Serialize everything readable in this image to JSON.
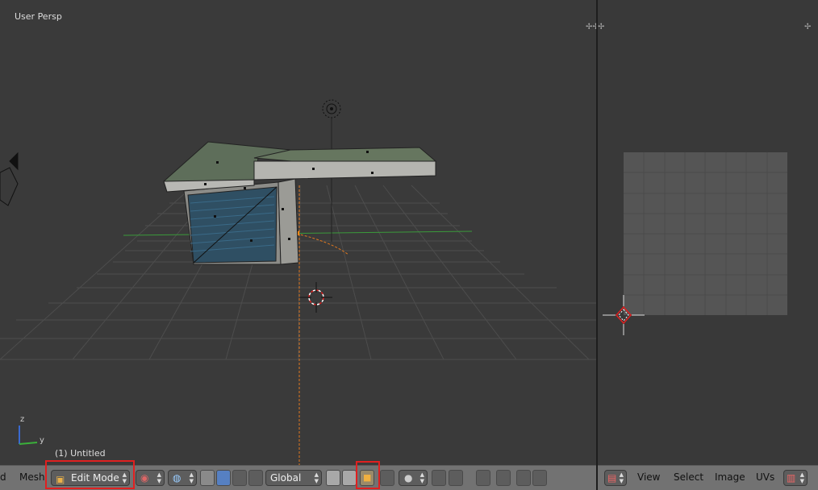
{
  "viewport": {
    "label": "User Persp",
    "object_label": "(1) Untitled",
    "axis_z": "z",
    "axis_y": "y"
  },
  "viewport_header": {
    "menu_partial": "d",
    "mesh_menu": "Mesh",
    "mode": "Edit Mode",
    "orientation": "Global"
  },
  "uv_header": {
    "view_menu": "View",
    "select_menu": "Select",
    "image_menu": "Image",
    "uvs_menu": "UVs"
  },
  "colors": {
    "highlight": "#e02020",
    "active_button": "#5680c2",
    "header": "#727272"
  },
  "icons": {
    "editor_type": "blender-uv-editor-icon",
    "mode": "edit-mode-icon",
    "snap": "magnet-icon"
  }
}
